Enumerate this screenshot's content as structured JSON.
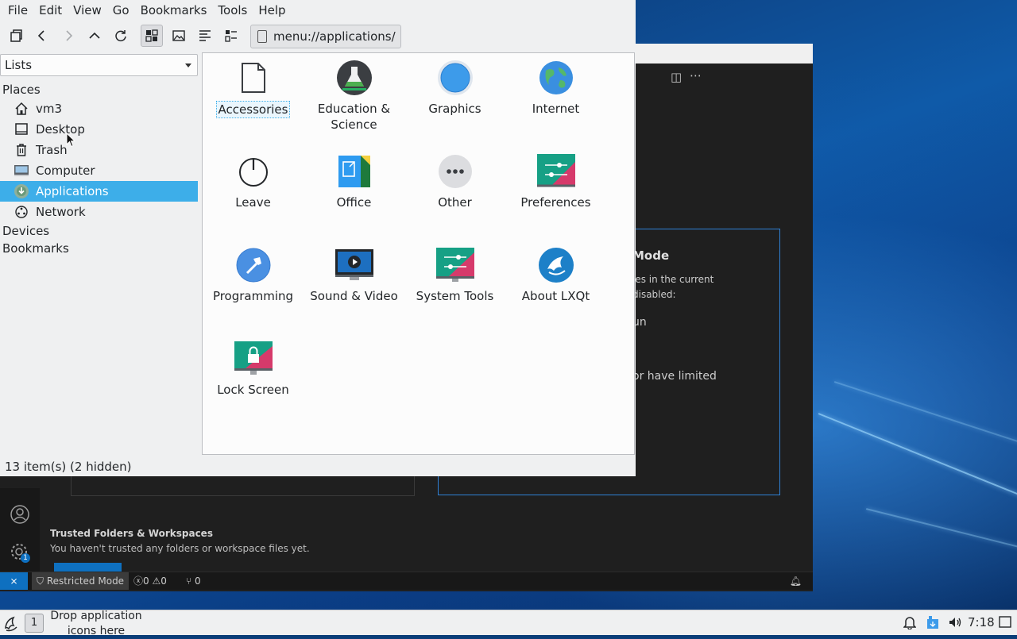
{
  "file_manager": {
    "menu": [
      "File",
      "Edit",
      "View",
      "Go",
      "Bookmarks",
      "Tools",
      "Help"
    ],
    "path": "menu://applications/",
    "side_pane_mode": "Lists",
    "places_header": "Places",
    "places": [
      {
        "label": "vm3",
        "icon": "home-icon"
      },
      {
        "label": "Desktop",
        "icon": "desktop-icon"
      },
      {
        "label": "Trash",
        "icon": "trash-icon"
      },
      {
        "label": "Computer",
        "icon": "computer-icon"
      },
      {
        "label": "Applications",
        "icon": "applications-icon",
        "selected": true
      },
      {
        "label": "Network",
        "icon": "network-icon"
      }
    ],
    "devices_header": "Devices",
    "bookmarks_header": "Bookmarks",
    "apps": [
      {
        "label": "Accessories",
        "icon": "document-icon"
      },
      {
        "label": "Education & Science",
        "icon": "flask-icon"
      },
      {
        "label": "Graphics",
        "icon": "graphics-icon"
      },
      {
        "label": "Internet",
        "icon": "globe-icon"
      },
      {
        "label": "Leave",
        "icon": "power-icon"
      },
      {
        "label": "Office",
        "icon": "office-icon"
      },
      {
        "label": "Other",
        "icon": "more-icon"
      },
      {
        "label": "Preferences",
        "icon": "preferences-icon"
      },
      {
        "label": "Programming",
        "icon": "hammer-icon"
      },
      {
        "label": "Sound & Video",
        "icon": "video-icon"
      },
      {
        "label": "System Tools",
        "icon": "system-tools-icon"
      },
      {
        "label": "About LXQt",
        "icon": "lxqt-logo-icon"
      },
      {
        "label": "Lock Screen",
        "icon": "lock-screen-icon"
      }
    ],
    "status": "13 item(s) (2 hidden)"
  },
  "background_window": {
    "card_title": "Mode",
    "card_line1": "les in the current",
    "card_line2": "disabled:",
    "card_line3": "un",
    "card_line4": "or have limited",
    "trusted_title": "Trusted Folders & Workspaces",
    "trusted_sub": "You haven't trusted any folders or workspace files yet.",
    "status_restricted": "Restricted Mode",
    "status_errors": "0",
    "status_warnings": "0",
    "status_ports": "0",
    "settings_badge": "1"
  },
  "taskbar": {
    "desktop_number": "1",
    "quicklaunch_placeholder": "Drop application icons here",
    "clock": "7:18"
  },
  "colors": {
    "selection": "#3daee9",
    "window_bg": "#eff0f1",
    "vscode_bg": "#1f1f1f",
    "vscode_accent": "#0e70c0"
  }
}
